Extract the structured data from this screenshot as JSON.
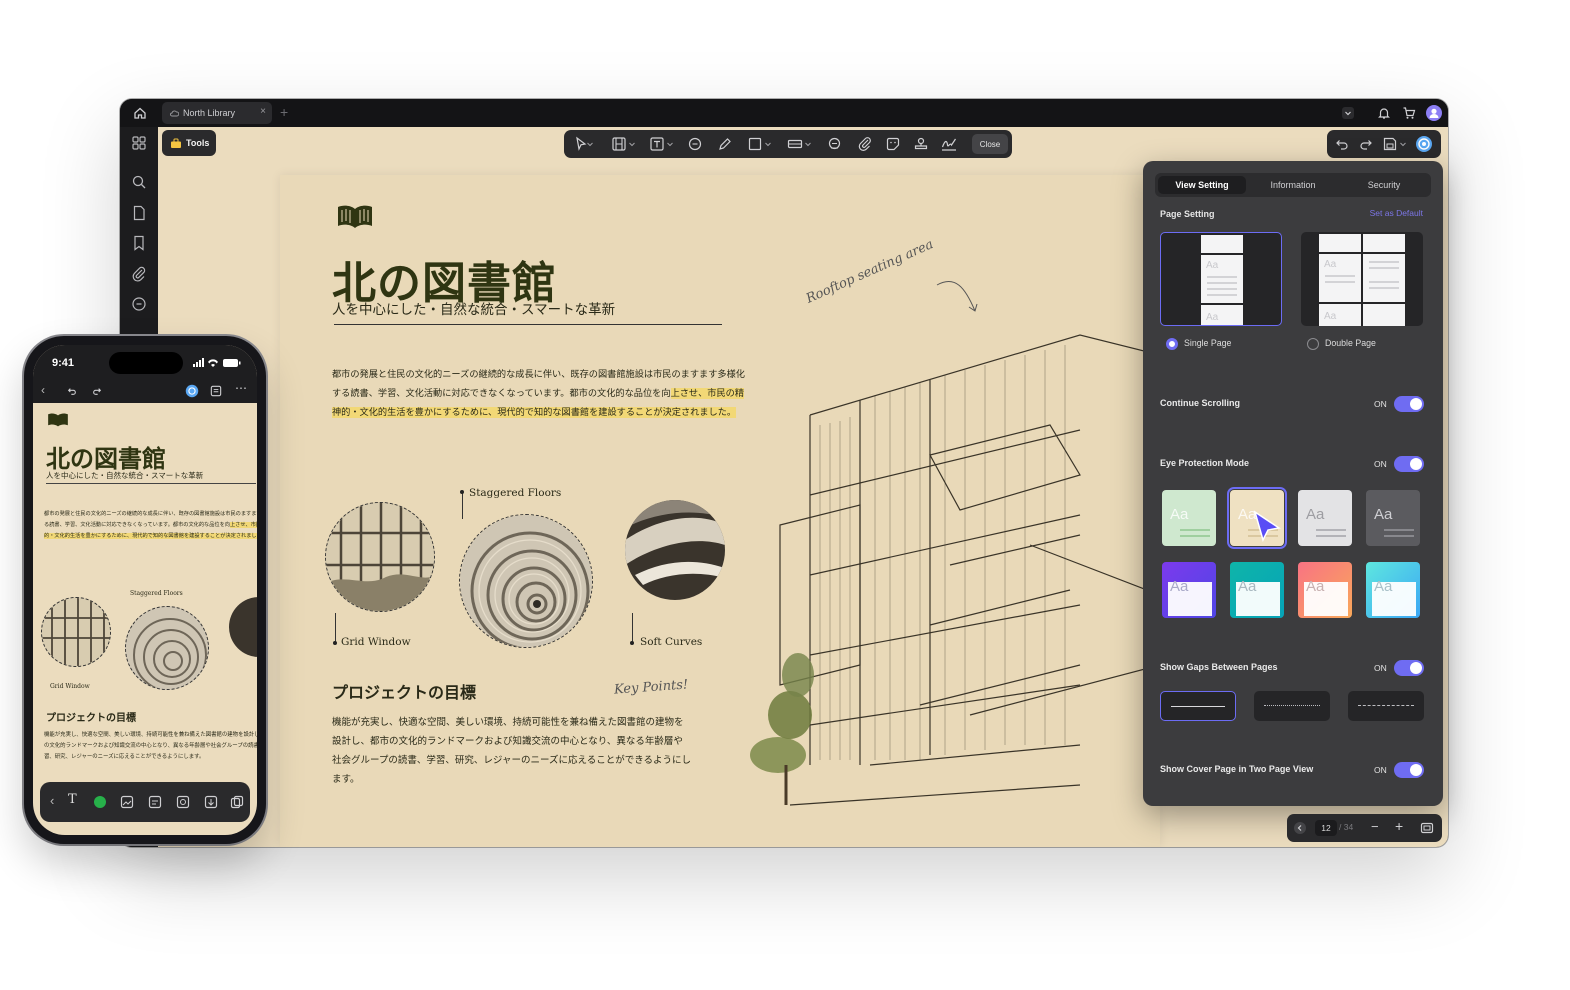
{
  "window": {
    "tab_title": "North Library",
    "tools_label": "Tools",
    "close_label": "Close"
  },
  "document": {
    "title": "北の図書館",
    "subtitle": "人を中心にした・自然な統合・スマートな革新",
    "paragraph1_part1": "都市の発展と住民の文化的ニーズの継続的な成長に伴い、既存の図書館施設は市民のますます多様化する読書、学習、文化活動に対応できなくなっています。都市の文化的な品位を向",
    "paragraph1_highlight": "上させ、市民の精神的・文化的生活を豊かにするために、現代的で知的な図書館を建設することが決定されました。",
    "label_staggered": "Staggered Floors",
    "label_grid": "Grid Window",
    "label_soft": "Soft Curves",
    "annotation_rooftop": "Rooftop seating area",
    "heading2": "プロジェクトの目標",
    "annotation_key": "Key Points!",
    "paragraph2": "機能が充実し、快適な空間、美しい環境、持続可能性を兼ね備えた図書館の建物を設計し、都市の文化的ランドマークおよび知識交流の中心となり、異なる年齢層や社会グループの読書、学習、研究、レジャーのニーズに応えることができるようにします。"
  },
  "panel": {
    "tabs": [
      "View Setting",
      "Information",
      "Security"
    ],
    "active_tab": 0,
    "page_setting_label": "Page Setting",
    "set_default_label": "Set as Default",
    "single_page_label": "Single Page",
    "double_page_label": "Double Page",
    "continue_scrolling_label": "Continue Scrolling",
    "continue_scrolling_state": "ON",
    "eye_protection_label": "Eye Protection Mode",
    "eye_protection_state": "ON",
    "swatch_text": "Aa",
    "gaps_label": "Show Gaps Between Pages",
    "gaps_state": "ON",
    "cover_label": "Show Cover Page in Two Page View",
    "cover_state": "ON",
    "accent_color": "#6f6cf2"
  },
  "pager": {
    "current": "12",
    "total": "/ 34"
  },
  "phone": {
    "time": "9:41"
  }
}
